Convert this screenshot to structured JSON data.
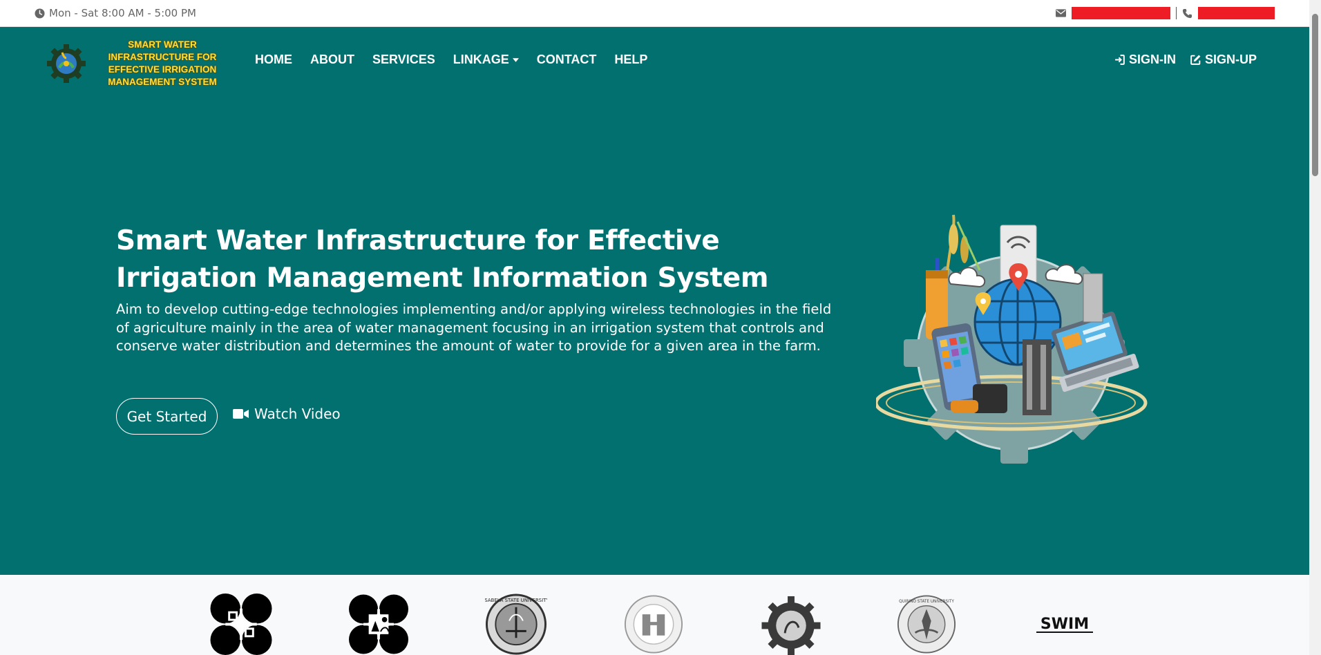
{
  "topbar": {
    "hours": "Mon - Sat 8:00 AM - 5:00 PM"
  },
  "header": {
    "logo_text": "SMART WATER INFRASTRUCTURE FOR EFFECTIVE IRRIGATION MANAGEMENT SYSTEM",
    "nav": [
      "HOME",
      "ABOUT",
      "SERVICES",
      "LINKAGE",
      "CONTACT",
      "HELP"
    ],
    "sign_in": "SIGN-IN",
    "sign_up": "SIGN-UP"
  },
  "hero": {
    "title": "Smart Water Infrastructure for Effective Irrigation Management Information System",
    "description": "Aim to develop cutting-edge technologies implementing and/or applying wireless technologies in the field of agriculture mainly in the area of water management focusing in an irrigation system that controls and conserve water distribution and determines the amount of water to provide for a given area in the farm.",
    "get_started": "Get Started",
    "watch_video": "Watch Video"
  },
  "partners": {
    "labels": [
      "ISABELA STATE UNIVERSITY",
      "QUIRINO STATE UNIVERSITY",
      "SWIM"
    ]
  },
  "colors": {
    "hero_bg": "#037070",
    "redaction": "#ee1c25",
    "logo_text": "#ffe033"
  }
}
